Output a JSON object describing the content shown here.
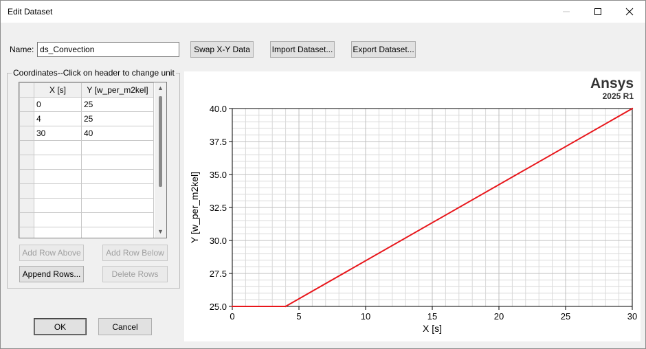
{
  "window": {
    "title": "Edit Dataset"
  },
  "name_field": {
    "label": "Name:",
    "value": "ds_Convection"
  },
  "toolbar": {
    "swap_label": "Swap X-Y Data",
    "import_label": "Import Dataset...",
    "export_label": "Export Dataset..."
  },
  "coordinates": {
    "group_title": "Coordinates--Click on header to change unit",
    "columns": [
      "X [s]",
      "Y [w_per_m2kel]"
    ],
    "rows": [
      [
        "0",
        "25"
      ],
      [
        "4",
        "25"
      ],
      [
        "30",
        "40"
      ],
      [
        "",
        ""
      ],
      [
        "",
        ""
      ],
      [
        "",
        ""
      ],
      [
        "",
        ""
      ],
      [
        "",
        ""
      ],
      [
        "",
        ""
      ],
      [
        "",
        ""
      ]
    ],
    "add_above_label": "Add Row Above",
    "add_below_label": "Add Row Below",
    "append_label": "Append Rows...",
    "delete_label": "Delete Rows"
  },
  "dialog": {
    "ok_label": "OK",
    "cancel_label": "Cancel"
  },
  "brand": {
    "name": "Ansys",
    "version": "2025 R1"
  },
  "colors": {
    "series": "#e8161b",
    "grid_minor": "#d9d9d9",
    "grid_major": "#bfbfbf"
  },
  "chart_data": {
    "type": "line",
    "xlabel": "X [s]",
    "ylabel": "Y [w_per_m2kel]",
    "x": [
      0,
      4,
      30
    ],
    "y": [
      25,
      25,
      40
    ],
    "xlim": [
      0,
      30
    ],
    "ylim": [
      25,
      40
    ],
    "xticks": [
      "0",
      "5",
      "10",
      "15",
      "20",
      "25",
      "30"
    ],
    "yticks": [
      "25.0",
      "27.5",
      "30.0",
      "32.5",
      "35.0",
      "37.5",
      "40.0"
    ],
    "grid": true
  }
}
